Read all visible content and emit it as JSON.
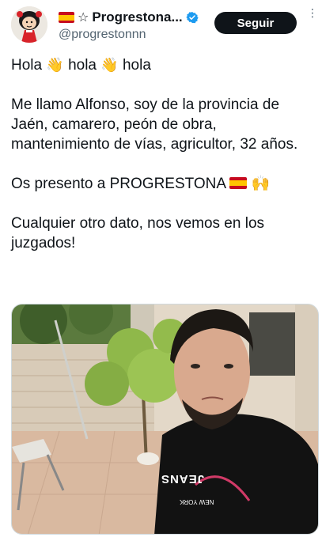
{
  "header": {
    "display_name": "Progrestona...",
    "star_glyph": "☆",
    "handle": "@progrestonnn",
    "follow_label": "Seguir",
    "avatar_icon": "mafalda-avatar-icon",
    "verified_icon": "verified-badge-icon",
    "flag_icon": "spain-flag-icon"
  },
  "post": {
    "line1": {
      "w1": "Hola",
      "w2": "hola",
      "w3": "hola",
      "emoji": "👋"
    },
    "paragraph2": "Me llamo Alfonso, soy de la provincia de Jaén, camarero, peón de obra, mantenimiento de vías, agricultor, 32 años.",
    "paragraph3_text": "Os presento a PROGRESTONA",
    "paragraph3_emoji": "🙌",
    "paragraph4": "Cualquier otro dato, nos vemos en los juzgados!"
  },
  "photo": {
    "shirt_text_1": "JEANS",
    "shirt_text_2": "NEW YORK"
  },
  "colors": {
    "text": "#0f1419",
    "muted": "#536471",
    "verified": "#1d9bf0",
    "button_bg": "#0f1419"
  }
}
